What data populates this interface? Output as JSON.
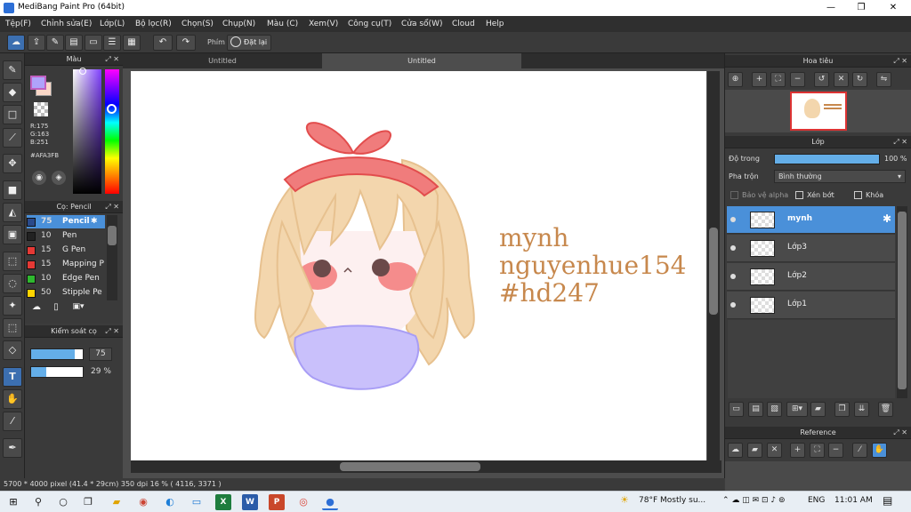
{
  "app": {
    "title": "MediBang Paint Pro (64bit)",
    "window_controls": [
      "—",
      "❐",
      "✕"
    ]
  },
  "menu": [
    "Tệp(F)",
    "Chỉnh sửa(E)",
    "Lớp(L)",
    "Bộ lọc(R)",
    "Chọn(S)",
    "Chụp(N)",
    "Màu (C)",
    "Xem(V)",
    "Công cụ(T)",
    "Cửa sổ(W)",
    "Cloud",
    "Help"
  ],
  "toolbar": {
    "shortcut_label": "Phím",
    "reset_label": "Đặt lại"
  },
  "color_panel": {
    "title": "Màu",
    "r": "R:175",
    "g": "G:163",
    "b": "B:251",
    "hex": "#AFA3FB",
    "primary_color": "#AFA3FB",
    "secondary_color": "#FAD7C7"
  },
  "brush_panel": {
    "title": "Cọ: Pencil",
    "brushes": [
      {
        "size": "75",
        "name": "Pencil",
        "color": "#2a4a8a"
      },
      {
        "size": "10",
        "name": "Pen",
        "color": "#222222"
      },
      {
        "size": "15",
        "name": "G Pen",
        "color": "#e53935"
      },
      {
        "size": "15",
        "name": "Mapping P",
        "color": "#e53935"
      },
      {
        "size": "10",
        "name": "Edge Pen",
        "color": "#2fb82f"
      },
      {
        "size": "50",
        "name": "Stipple Pe",
        "color": "#ffd400"
      }
    ]
  },
  "control_panel": {
    "title": "Kiểm soát cọ",
    "size_value": "75",
    "opacity_value": "29 %",
    "size_fraction": 0.85,
    "opacity_fraction": 0.29
  },
  "tabs": [
    "Untitled",
    "Untitled"
  ],
  "canvas": {
    "watermark_lines": [
      "mynh",
      "nguyenhue154",
      "#hd247"
    ]
  },
  "status": {
    "text": "5700 * 4000 pixel   (41.4 * 29cm)   350 dpi   16 %   ( 4116, 3371 )"
  },
  "navigator": {
    "title": "Hoa tiêu"
  },
  "layer_panel": {
    "title": "Lớp",
    "opacity_label": "Độ trong",
    "opacity_value": "100 %",
    "opacity_fraction": 1.0,
    "blend_label": "Pha trộn",
    "blend_value": "Bình thường",
    "protect_alpha": "Bảo vệ alpha",
    "clip": "Xén bớt",
    "lock": "Khóa",
    "layers": [
      "mynh",
      "Lớp3",
      "Lớp2",
      "Lớp1"
    ]
  },
  "reference": {
    "title": "Reference"
  },
  "taskbar": {
    "weather": "78°F  Mostly su...",
    "lang": "ENG",
    "time": "11:01 AM"
  }
}
